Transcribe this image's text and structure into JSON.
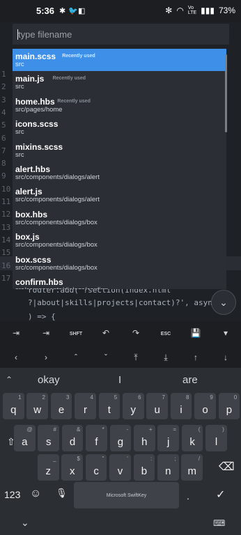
{
  "status": {
    "time": "5:36",
    "battery": "73%",
    "left_icons": [
      "gear-icon",
      "twitter-icon",
      "notes-icon"
    ],
    "right_icons": [
      "bluetooth-icon",
      "wifi-icon",
      "volte-icon",
      "signal-icon"
    ]
  },
  "search": {
    "placeholder": "type filename"
  },
  "files": [
    {
      "name": "main.scss",
      "path": "src",
      "badge": "Recently used",
      "selected": true
    },
    {
      "name": "main.js",
      "path": "src",
      "badge": "Recently used"
    },
    {
      "name": "home.hbs",
      "path": "src/pages/home",
      "badge": "Recently used"
    },
    {
      "name": "icons.scss",
      "path": "src"
    },
    {
      "name": "mixins.scss",
      "path": "src"
    },
    {
      "name": "alert.hbs",
      "path": "src/components/dialogs/alert"
    },
    {
      "name": "alert.js",
      "path": "src/components/dialogs/alert"
    },
    {
      "name": "box.hbs",
      "path": "src/components/dialogs/box"
    },
    {
      "name": "box.js",
      "path": "src/components/dialogs/box"
    },
    {
      "name": "box.scss",
      "path": "src/components/dialogs/box"
    },
    {
      "name": "confirm.hbs",
      "path": "src/components/dialogs/confirm"
    }
  ],
  "editor": {
    "line_numbers": [
      "1",
      "2",
      "3",
      "4",
      "5",
      "6",
      "7",
      "8",
      "9",
      "10",
      "11",
      "12",
      "13",
      "14",
      "15",
      "16",
      "17"
    ],
    "code_lines": [
      "router.add('?section(index.html",
      "?|about|skills|projects|contact)?', async",
      ") => {"
    ]
  },
  "extra_keys": [
    "tab-icon",
    "SHFT",
    "undo-icon",
    "redo-icon",
    "ESC",
    "save-icon",
    "chevron-down-icon"
  ],
  "arrow_keys": [
    "left",
    "right",
    "up",
    "down",
    "home",
    "end",
    "pgup",
    "pgdn"
  ],
  "suggestions": [
    "okay",
    "I",
    "are"
  ],
  "keys": {
    "row1": [
      [
        "q",
        "1"
      ],
      [
        "w",
        "2"
      ],
      [
        "e",
        "3"
      ],
      [
        "r",
        "4"
      ],
      [
        "t",
        "5"
      ],
      [
        "y",
        "6"
      ],
      [
        "u",
        "7"
      ],
      [
        "i",
        "8"
      ],
      [
        "o",
        "9"
      ],
      [
        "p",
        "0"
      ]
    ],
    "row2": [
      [
        "a",
        "@"
      ],
      [
        "s",
        "#"
      ],
      [
        "d",
        "&"
      ],
      [
        "f",
        "*"
      ],
      [
        "g",
        "-"
      ],
      [
        "h",
        "+"
      ],
      [
        "j",
        "="
      ],
      [
        "k",
        "("
      ],
      [
        "l",
        ")"
      ]
    ],
    "row3": [
      [
        "z",
        "_"
      ],
      [
        "x",
        "$"
      ],
      [
        "c",
        "\""
      ],
      [
        "v",
        "'"
      ],
      [
        "b",
        ":"
      ],
      [
        "n",
        ";"
      ],
      [
        "m",
        "/"
      ]
    ],
    "num_label": "123",
    "space_label": "Microsoft SwiftKey"
  }
}
